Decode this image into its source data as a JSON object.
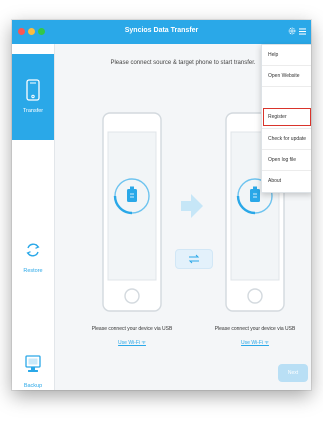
{
  "window": {
    "title": "Syncios Data Transfer"
  },
  "header": {
    "settings_icon": "gear-icon",
    "menu_icon": "hamburger-menu-icon"
  },
  "sidebar": {
    "items": [
      {
        "label": "Transfer",
        "icon": "phone-icon",
        "active": true
      },
      {
        "label": "Restore",
        "icon": "restore-icon",
        "active": false
      },
      {
        "label": "Backup",
        "icon": "computer-icon",
        "active": false
      }
    ]
  },
  "main": {
    "instruction": "Please connect source & target phone to start transfer.",
    "left_device": {
      "connect_text": "Please connect your device via USB",
      "wifi_link": "Use Wi-Fi ᯤ"
    },
    "right_device": {
      "connect_text": "Please connect your device via USB",
      "wifi_link": "Use Wi-Fi ᯤ"
    },
    "next_label": "Next"
  },
  "menu": {
    "items": [
      {
        "label": "Help"
      },
      {
        "label": "Open Website"
      },
      {
        "label": "Register",
        "highlighted": true
      },
      {
        "label": "Check for update"
      },
      {
        "label": "Open log file"
      },
      {
        "label": "About"
      }
    ]
  },
  "colors": {
    "accent": "#2aa8e8",
    "highlight_border": "#d9342b"
  }
}
